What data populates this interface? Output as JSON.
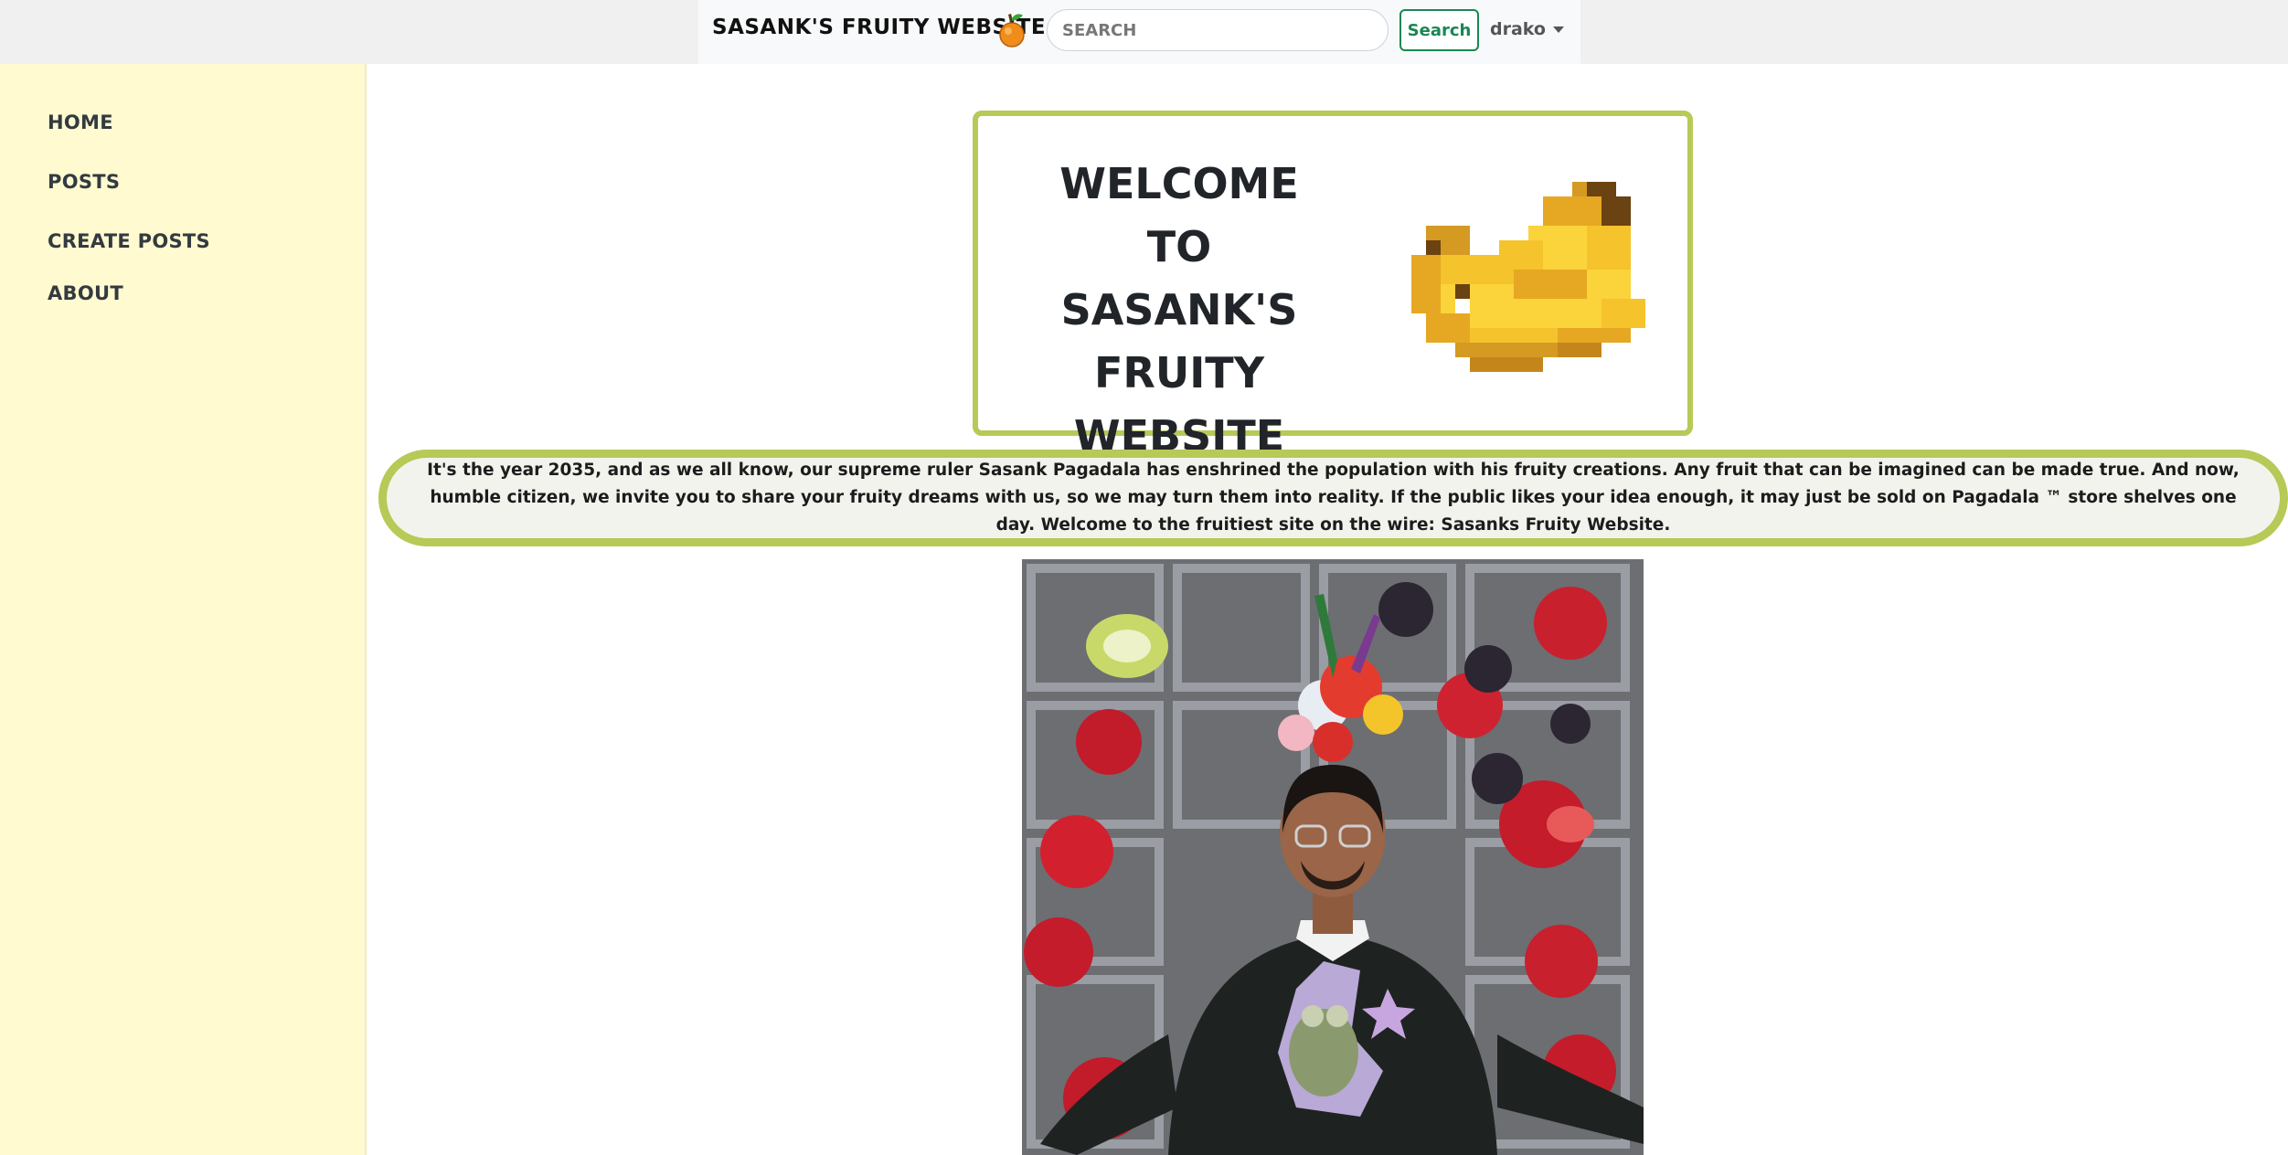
{
  "navbar": {
    "brand": "SASANK'S FRUITY WEBSITE",
    "search_placeholder": "SEARCH",
    "search_button": "Search",
    "user": "drako"
  },
  "sidebar": {
    "items": [
      {
        "label": "HOME"
      },
      {
        "label": "POSTS"
      },
      {
        "label": "CREATE POSTS"
      },
      {
        "label": "ABOUT"
      }
    ]
  },
  "welcome": {
    "line1": "WELCOME",
    "line2": "TO",
    "line3": "SASANK'S FRUITY",
    "line4": "WEBSITE"
  },
  "intro": "It's the year 2035, and as we all know, our supreme ruler Sasank Pagadala has enshrined the population with his fruity creations. Any fruit that can be imagined can be made true. And now, humble citizen, we invite you to share your fruity dreams with us, so we may turn them into reality. If the public likes your idea enough, it may just be sold on Pagadala ™ store shelves one day. Welcome to the fruitiest site on the wire: Sasanks Fruity Website.",
  "colors": {
    "accent_green": "#b7c957",
    "sidebar_bg": "#fffad0",
    "search_button": "#198754"
  },
  "icons": [
    "orange-icon",
    "pixel-banana-image",
    "chevron-down-icon"
  ]
}
